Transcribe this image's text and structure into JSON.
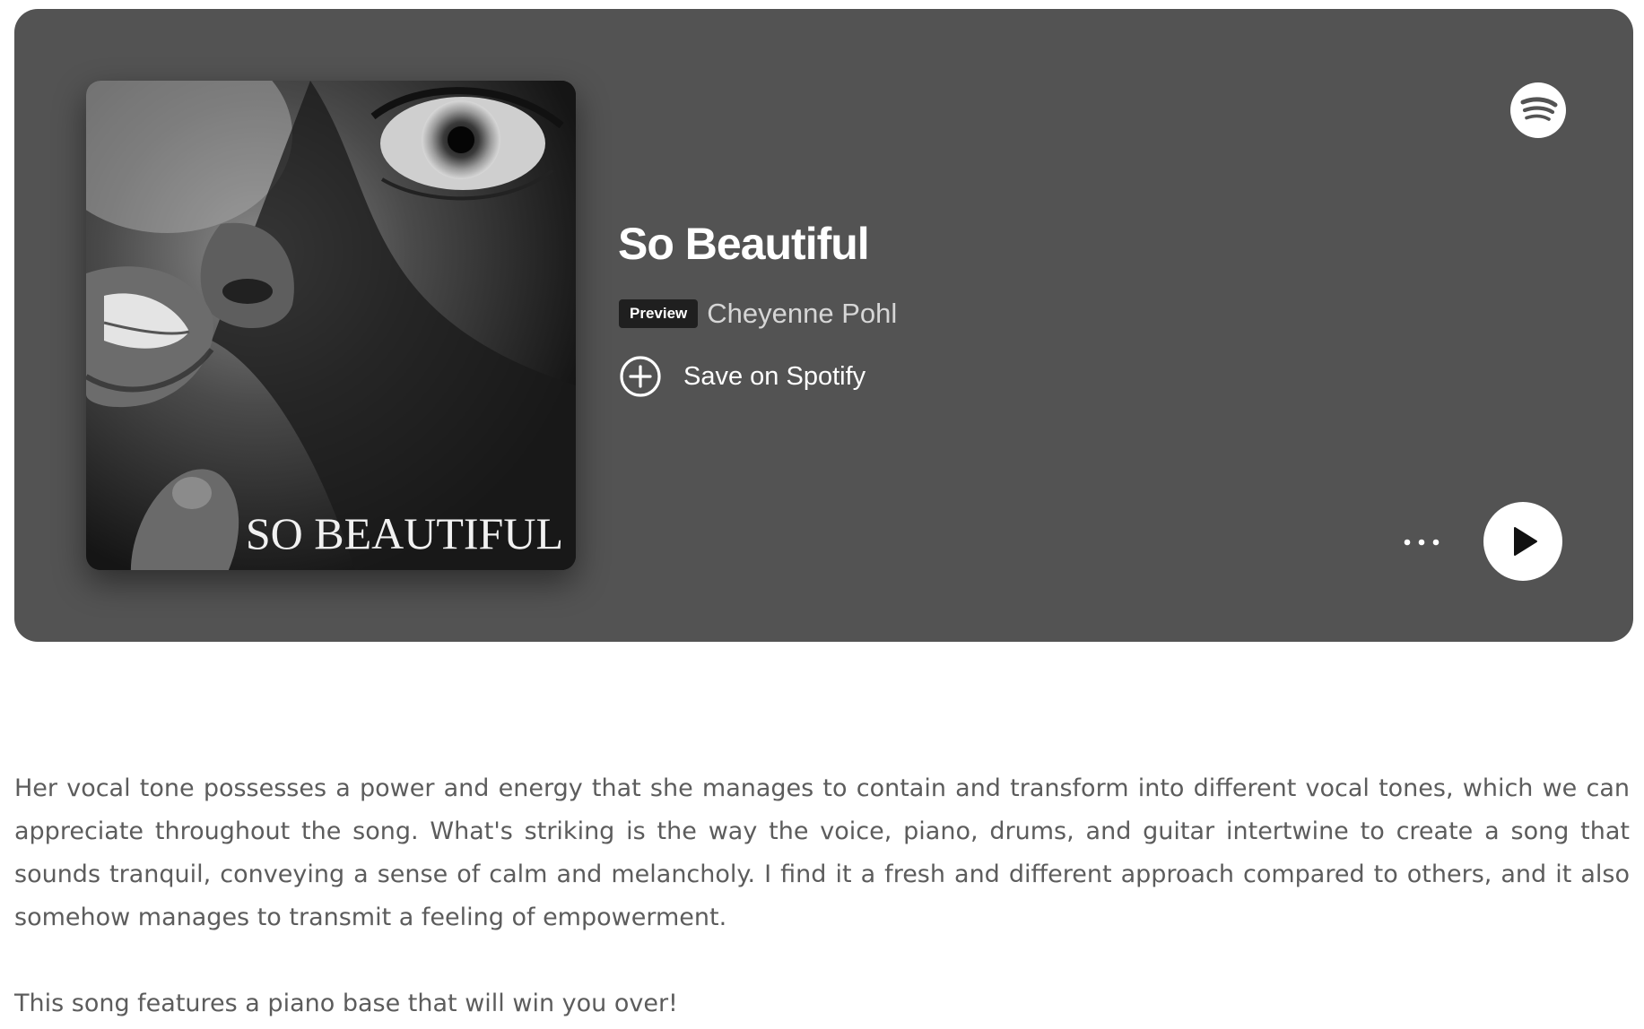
{
  "track": {
    "title": "So Beautiful",
    "badge": "Preview",
    "artist": "Cheyenne Pohl",
    "save_label": "Save on Spotify",
    "cover_text": "SO BEAUTIFUL"
  },
  "icons": {
    "logo": "spotify-logo-icon",
    "save": "plus-circle-icon",
    "more": "ellipsis-icon",
    "play": "play-icon"
  },
  "colors": {
    "embed_background": "#535353",
    "badge_background": "#1f1f1f",
    "body_text": "#5c5c5c",
    "play_button": "#ffffff"
  },
  "article": {
    "paragraphs": [
      "Her vocal tone possesses a power and energy that she manages to contain and transform into different vocal tones, which we can appreciate throughout the song. What's striking is the way the voice, piano, drums, and guitar intertwine to create a song that sounds tranquil, conveying a sense of calm and melancholy. I find it a fresh and different approach compared to others, and it also somehow manages to transmit a feeling of empowerment.",
      "This song features a piano base that will win you over!"
    ]
  }
}
